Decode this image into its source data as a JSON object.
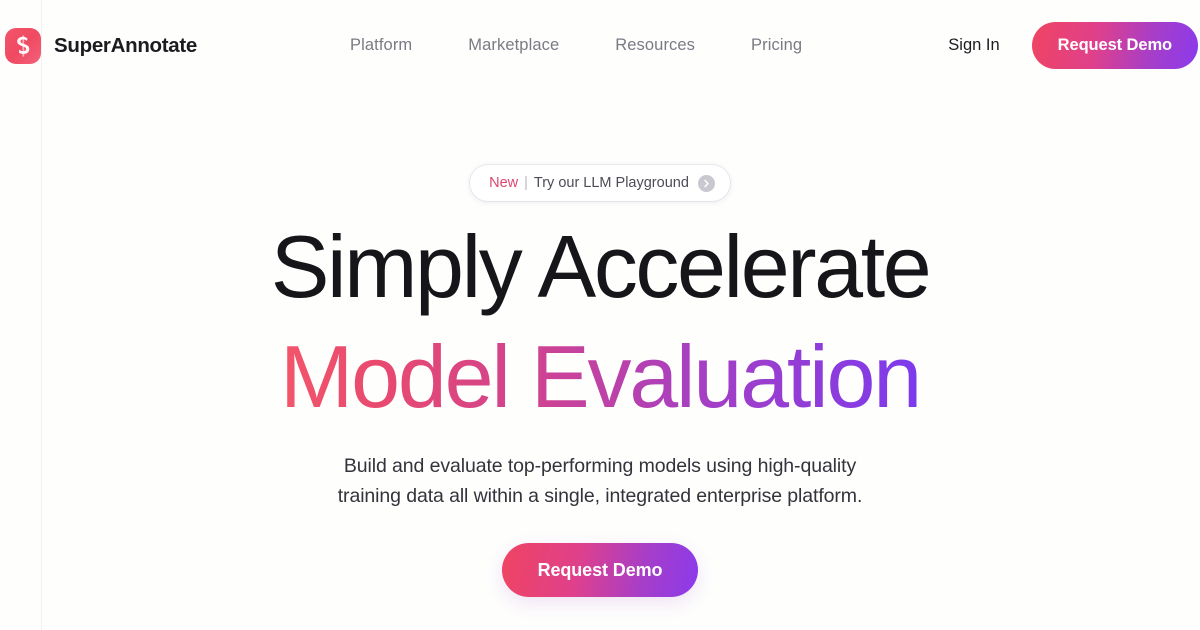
{
  "colors": {
    "accent_pink": "#ef4462",
    "accent_purple": "#8b3aec",
    "brand_mark_start": "#f4556c",
    "brand_mark_end": "#f2627a",
    "nav_link": "#7a7a85",
    "headline": "#16161a",
    "badge_new": "#dd4770",
    "page_background": "#fefefd"
  },
  "header": {
    "brand": {
      "logo_icon": "superannotate-s-logo-icon",
      "name": "SuperAnnotate"
    },
    "nav_items": [
      {
        "label": "Platform"
      },
      {
        "label": "Marketplace"
      },
      {
        "label": "Resources"
      },
      {
        "label": "Pricing"
      }
    ],
    "sign_in_label": "Sign In",
    "request_demo_label": "Request Demo"
  },
  "hero": {
    "announcement": {
      "tag": "New",
      "separator": "|",
      "text": "Try our LLM Playground",
      "arrow_icon": "chevron-right-circle-icon"
    },
    "headline_line1": "Simply Accelerate",
    "headline_line2": "Model Evaluation",
    "subtitle_line1": "Build and evaluate top-performing models using high-quality",
    "subtitle_line2": "training data all within a single, integrated enterprise platform.",
    "cta_label": "Request Demo"
  }
}
